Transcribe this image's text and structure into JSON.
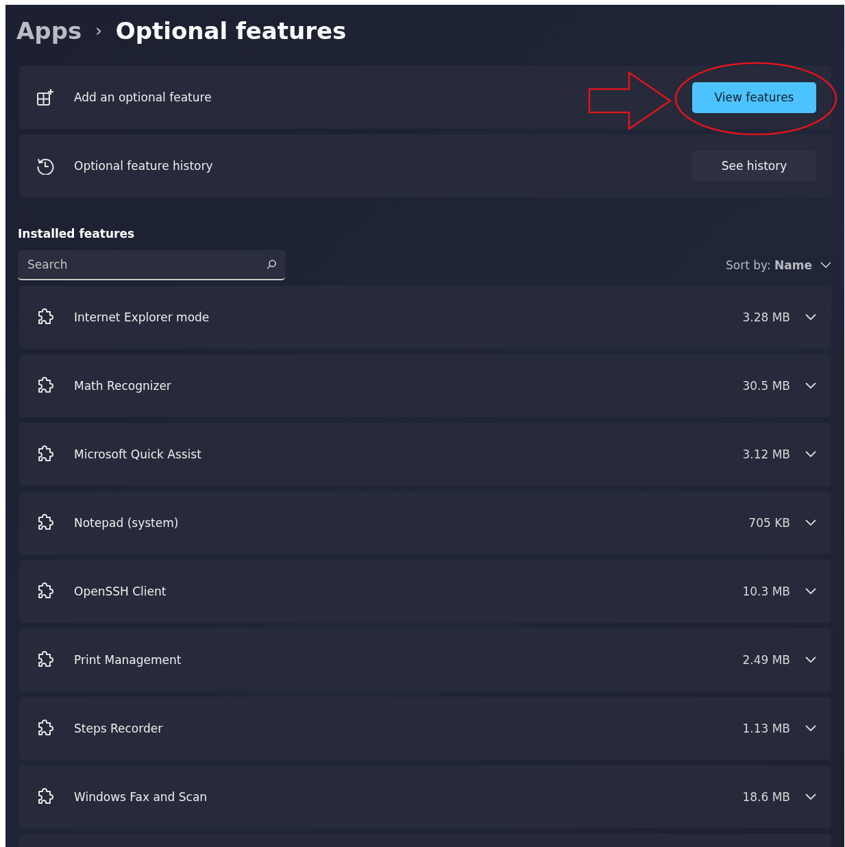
{
  "breadcrumb": {
    "parent": "Apps",
    "separator": "›",
    "current": "Optional features"
  },
  "actions": [
    {
      "kind": "add",
      "label": "Add an optional feature",
      "button": "View features",
      "primary": true
    },
    {
      "kind": "history",
      "label": "Optional feature history",
      "button": "See history",
      "primary": false
    }
  ],
  "installed": {
    "heading": "Installed features",
    "search": {
      "placeholder": "Search"
    },
    "sort": "Sort by: **Name**",
    "features": [
      {
        "name": "Internet Explorer mode",
        "size": "3.28 MB",
        "expanded": false
      },
      {
        "name": "Math Recognizer",
        "size": "30.5 MB",
        "expanded": false
      },
      {
        "name": "Microsoft Quick Assist",
        "size": "3.12 MB",
        "expanded": false
      },
      {
        "name": "Notepad (system)",
        "size": "705 KB",
        "expanded": false
      },
      {
        "name": "OpenSSH Client",
        "size": "10.3 MB",
        "expanded": false
      },
      {
        "name": "Print Management",
        "size": "2.49 MB",
        "expanded": false
      },
      {
        "name": "Steps Recorder",
        "size": "1.13 MB",
        "expanded": false
      },
      {
        "name": "Windows Fax and Scan",
        "size": "18.6 MB",
        "expanded": false
      }
    ]
  }
}
